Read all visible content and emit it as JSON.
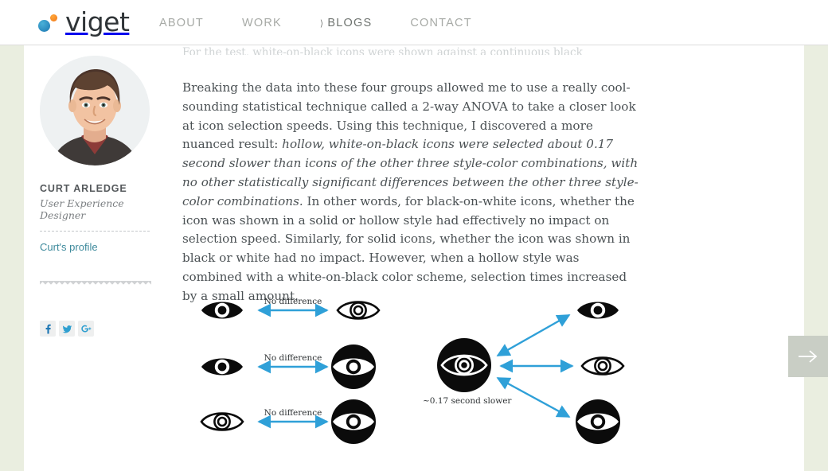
{
  "site": {
    "logo_text": "viget",
    "logo_dot_blue": "#2a88bd",
    "logo_dot_orange": "#f58220"
  },
  "nav": {
    "items": [
      {
        "label": "ABOUT",
        "active": false,
        "chevron": false
      },
      {
        "label": "WORK",
        "active": false,
        "chevron": false
      },
      {
        "label": "BLOGS",
        "active": true,
        "chevron": true
      },
      {
        "label": "CONTACT",
        "active": false,
        "chevron": false
      }
    ]
  },
  "sidebar": {
    "author_name": "CURT ARLEDGE",
    "author_role": "User Experience Designer",
    "profile_link": "Curt's profile",
    "social": [
      {
        "name": "facebook",
        "glyph": "f"
      },
      {
        "name": "twitter",
        "glyph": "t"
      },
      {
        "name": "google-plus",
        "glyph": "g+"
      }
    ]
  },
  "article": {
    "cut_line": "For the test, white-on-black icons were shown against a continuous black background.)",
    "paragraph_parts": {
      "p1": "Breaking the data into these four groups allowed me to use a really cool-sounding statistical technique called a 2-way ANOVA to take a closer look at icon selection speeds. Using this technique, I discovered a more nuanced result: ",
      "p2_italic": "hollow, white-on-black icons were selected about 0.17 second slower than icons of the other three style-color combinations, with no other statistically significant differences between the other three style-color combinations.",
      "p3": " In other words, for black-on-white icons, whether the icon was shown in a solid or hollow style had effectively no impact on selection speed. Similarly, for solid icons, whether the icon was shown in black or white had no impact. However, when a hollow style was combined with a white-on-black color scheme, selection times increased by a small amount."
    }
  },
  "figure": {
    "arrow_color": "#2fa0d8",
    "no_difference_label": "No difference",
    "slower_label": "~0.17 second slower",
    "left_rows": [
      {
        "left_icon": "eye-solid-black-on-white",
        "right_icon": "eye-hollow-black-on-white",
        "label": "No difference"
      },
      {
        "left_icon": "eye-solid-black-on-white",
        "right_icon": "eye-solid-white-on-black",
        "label": "No difference"
      },
      {
        "left_icon": "eye-hollow-black-on-white",
        "right_icon": "eye-solid-white-on-black",
        "label": "No difference"
      }
    ],
    "right_group": {
      "center_icon": "eye-hollow-white-on-black",
      "targets": [
        "eye-solid-black-on-white",
        "eye-hollow-black-on-white",
        "eye-solid-white-on-black"
      ]
    }
  },
  "pager": {
    "next_label": "Next"
  },
  "colors": {
    "page_margin": "#eaeee0",
    "content_bg": "#ffffff",
    "body_text": "#4b5154",
    "link": "#3e8a9c",
    "nav_inactive": "#a7aaa6",
    "nav_active": "#6f7470",
    "pager_bg": "#c9cec5"
  }
}
